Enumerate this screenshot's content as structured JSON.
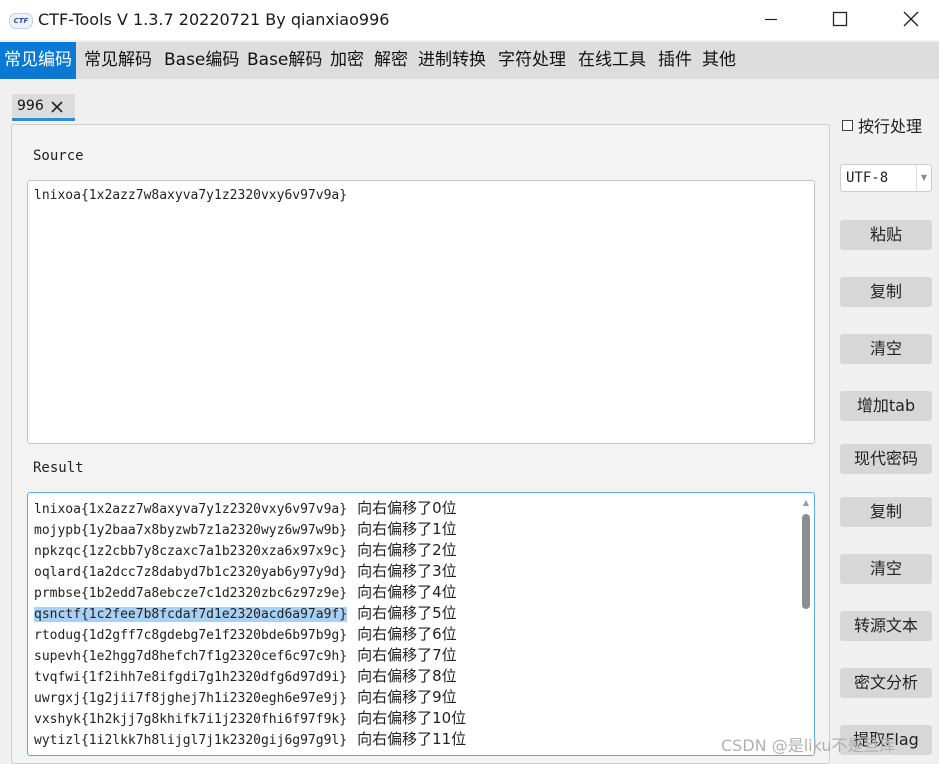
{
  "window": {
    "title": "CTF-Tools V 1.3.7 20220721 By qianxiao996",
    "icon_text": "CTF",
    "controls": [
      "minimize-icon",
      "maximize-icon",
      "close-icon"
    ]
  },
  "menu": [
    {
      "label": "常见编码",
      "active": true
    },
    {
      "label": "常见解码"
    },
    {
      "label": "Base编码"
    },
    {
      "label": "Base解码"
    },
    {
      "label": "加密"
    },
    {
      "label": "解密"
    },
    {
      "label": "进制转换"
    },
    {
      "label": "字符处理"
    },
    {
      "label": "在线工具"
    },
    {
      "label": "插件"
    },
    {
      "label": "其他"
    }
  ],
  "tab": {
    "label": "996",
    "close_icon": "close-icon"
  },
  "source": {
    "label": "Source",
    "text": "lnixoa{1x2azz7w8axyva7y1z2320vxy6v97v9a}"
  },
  "result": {
    "label": "Result",
    "selected_index": 5,
    "lines": [
      {
        "code": "lnixoa{1x2azz7w8axyva7y1z2320vxy6v97v9a}",
        "shift": "向右偏移了0位"
      },
      {
        "code": "mojypb{1y2baa7x8byzwb7z1a2320wyz6w97w9b}",
        "shift": "向右偏移了1位"
      },
      {
        "code": "npkzqc{1z2cbb7y8czaxc7a1b2320xza6x97x9c}",
        "shift": "向右偏移了2位"
      },
      {
        "code": "oqlard{1a2dcc7z8dabyd7b1c2320yab6y97y9d}",
        "shift": "向右偏移了3位"
      },
      {
        "code": "prmbse{1b2edd7a8ebcze7c1d2320zbc6z97z9e}",
        "shift": "向右偏移了4位"
      },
      {
        "code": "qsnctf{1c2fee7b8fcdaf7d1e2320acd6a97a9f}",
        "shift": "向右偏移了5位"
      },
      {
        "code": "rtodug{1d2gff7c8gdebg7e1f2320bde6b97b9g}",
        "shift": "向右偏移了6位"
      },
      {
        "code": "supevh{1e2hgg7d8hefch7f1g2320cef6c97c9h}",
        "shift": "向右偏移了7位"
      },
      {
        "code": "tvqfwi{1f2ihh7e8ifgdi7g1h2320dfg6d97d9i}",
        "shift": "向右偏移了8位"
      },
      {
        "code": "uwrgxj{1g2jii7f8jghej7h1i2320egh6e97e9j}",
        "shift": "向右偏移了9位"
      },
      {
        "code": "vxshyk{1h2kjj7g8khifk7i1j2320fhi6f97f9k}",
        "shift": "向右偏移了10位"
      },
      {
        "code": "wytizl{1i2lkk7h8lijgl7j1k2320gij6g97g9l}",
        "shift": "向右偏移了11位"
      }
    ]
  },
  "sidebar": {
    "checkbox_label": "按行处理",
    "checkbox_checked": false,
    "encoding": "UTF-8",
    "buttons": {
      "paste": "粘贴",
      "copy_source": "复制",
      "clear_source": "清空",
      "add_tab": "增加tab",
      "modern_cipher": "现代密码",
      "copy_result": "复制",
      "clear_result": "清空",
      "to_source": "转源文本",
      "cipher_analysis": "密文分析",
      "partial": "提取Flag"
    }
  },
  "watermark": "CSDN @是liku不是旦库"
}
